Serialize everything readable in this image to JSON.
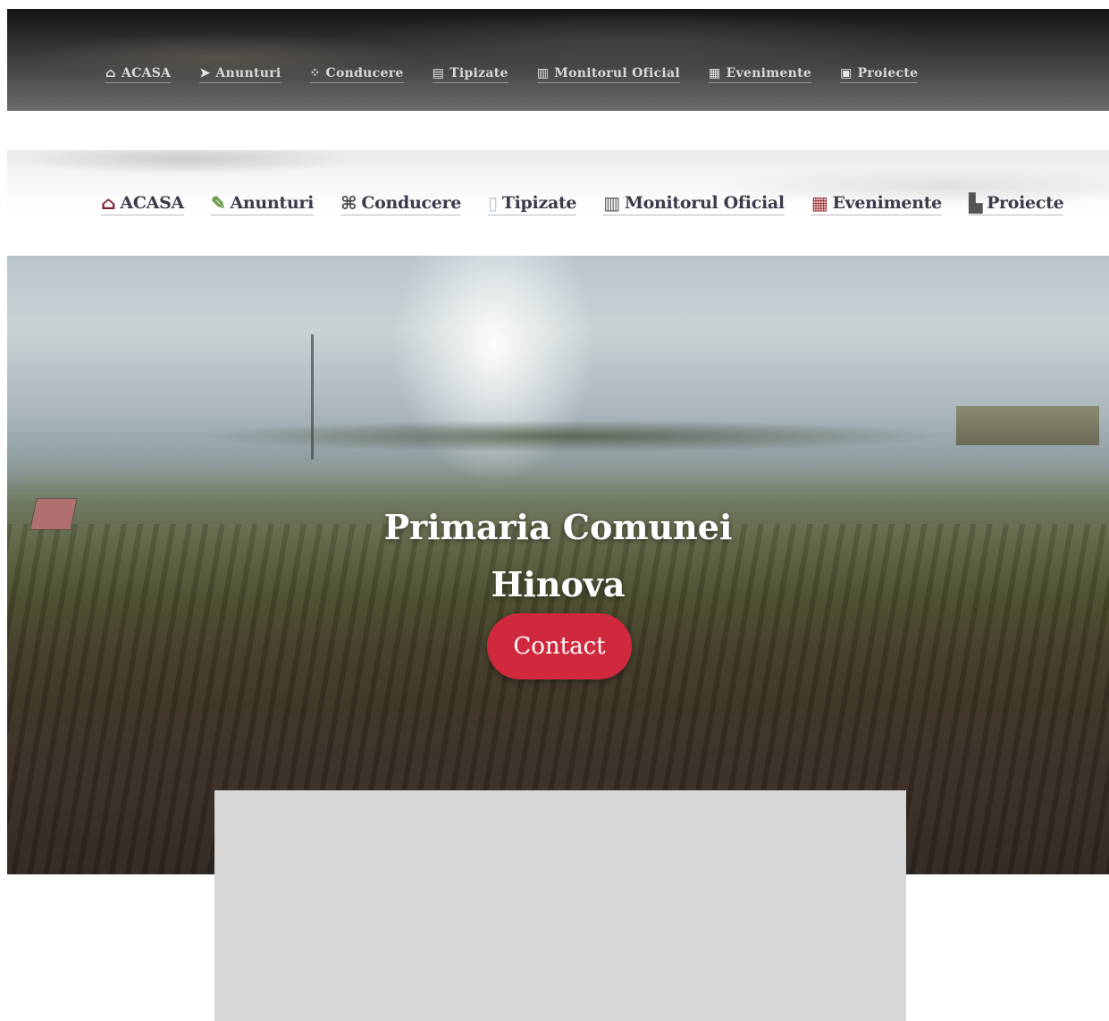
{
  "dark_nav": {
    "items": [
      {
        "label": "ACASA",
        "icon": "home-icon",
        "glyph": "⌂"
      },
      {
        "label": "Anunturi",
        "icon": "megaphone-icon",
        "glyph": "➤"
      },
      {
        "label": "Conducere",
        "icon": "people-icon",
        "glyph": "⁘"
      },
      {
        "label": "Tipizate",
        "icon": "document-icon",
        "glyph": "▤"
      },
      {
        "label": "Monitorul Oficial",
        "icon": "book-icon",
        "glyph": "▥"
      },
      {
        "label": "Evenimente",
        "icon": "calendar-icon",
        "glyph": "▦"
      },
      {
        "label": "Proiecte",
        "icon": "project-icon",
        "glyph": "▣"
      }
    ]
  },
  "light_nav": {
    "items": [
      {
        "label": "ACASA",
        "icon": "home-icon",
        "glyph": "⌂"
      },
      {
        "label": "Anunturi",
        "icon": "megaphone-icon",
        "glyph": "✎"
      },
      {
        "label": "Conducere",
        "icon": "people-icon",
        "glyph": "⌘"
      },
      {
        "label": "Tipizate",
        "icon": "document-icon",
        "glyph": "▯"
      },
      {
        "label": "Monitorul Oficial",
        "icon": "book-icon",
        "glyph": "▥"
      },
      {
        "label": "Evenimente",
        "icon": "calendar-icon",
        "glyph": "▦"
      },
      {
        "label": "Proiecte",
        "icon": "project-icon",
        "glyph": "▙"
      }
    ]
  },
  "hero": {
    "title_line1": "Primaria Comunei",
    "title_line2": "Hinova",
    "contact_label": "Contact"
  },
  "colors": {
    "accent": "#d0293d",
    "dark_nav_text": "#d9d9d9",
    "light_nav_text": "#3a3a4a"
  }
}
